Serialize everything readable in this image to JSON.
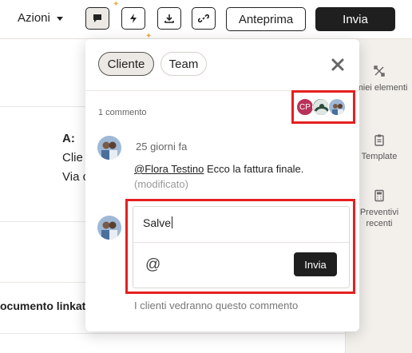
{
  "toolbar": {
    "actions_label": "Azioni",
    "preview_label": "Anteprima",
    "send_label": "Invia",
    "icons": [
      "comment-icon",
      "lightning-icon",
      "download-icon",
      "link-icon"
    ]
  },
  "document": {
    "to_label": "A:",
    "line1": "Clie",
    "line2": "Via c",
    "linked_doc": "ocumento linkato"
  },
  "right_panel": {
    "items": [
      {
        "icon": "tools-icon",
        "label": "I miei elementi"
      },
      {
        "icon": "clipboard-icon",
        "label": "Template"
      },
      {
        "icon": "calculator-icon",
        "label": "Preventivi recenti"
      }
    ]
  },
  "popover": {
    "tabs": [
      {
        "label": "Cliente",
        "active": true
      },
      {
        "label": "Team",
        "active": false
      }
    ],
    "comment_count": "1 commento",
    "participants": [
      {
        "initials": "CP",
        "color": "#b8325a"
      },
      {
        "initials": "",
        "color": "#2e4b3b"
      },
      {
        "initials": "",
        "color": "#8fa7c4"
      }
    ],
    "comment": {
      "time": "25 giorni fa",
      "mention": "@Flora Testino",
      "text": " Ecco la fattura finale.",
      "edited": "(modificato)"
    },
    "reply": {
      "value": "Salve",
      "mention_symbol": "@",
      "send_label": "Invia"
    },
    "note": "I clienti vedranno questo commento"
  },
  "colors": {
    "accent_dark": "#1f1f1f",
    "highlight": "#e52020",
    "sparkle": "#e8b54a"
  }
}
